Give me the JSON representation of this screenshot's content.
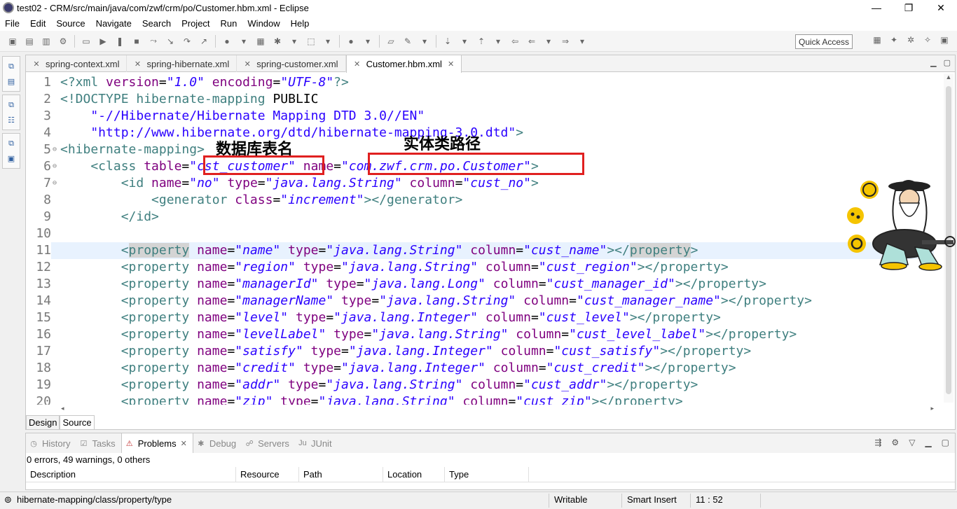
{
  "window": {
    "title": "test02 - CRM/src/main/java/com/zwf/crm/po/Customer.hbm.xml - Eclipse",
    "minimize": "—",
    "restore": "❐",
    "close": "✕"
  },
  "menu": [
    "File",
    "Edit",
    "Source",
    "Navigate",
    "Search",
    "Project",
    "Run",
    "Window",
    "Help"
  ],
  "toolbar": {
    "quick_access": "Quick Access"
  },
  "editor_tabs": [
    {
      "label": "spring-context.xml",
      "active": false
    },
    {
      "label": "spring-hibernate.xml",
      "active": false
    },
    {
      "label": "spring-customer.xml",
      "active": false
    },
    {
      "label": "Customer.hbm.xml",
      "active": true
    }
  ],
  "code_lines": [
    {
      "n": "1",
      "fold": "",
      "segs": [
        [
          "k",
          "<?xml "
        ],
        [
          "a",
          "version"
        ],
        [
          "p",
          "="
        ],
        [
          "v",
          "\"1.0\""
        ],
        [
          "a",
          " encoding"
        ],
        [
          "p",
          "="
        ],
        [
          "v",
          "\"UTF-8\""
        ],
        [
          "k",
          "?>"
        ]
      ]
    },
    {
      "n": "2",
      "fold": "",
      "segs": [
        [
          "k",
          "<!DOCTYPE hibernate-mapping "
        ],
        [
          "p",
          "PUBLIC"
        ]
      ]
    },
    {
      "n": "3",
      "fold": "",
      "segs": [
        [
          "dq",
          "    \"-//Hibernate/Hibernate Mapping DTD 3.0//EN\""
        ]
      ]
    },
    {
      "n": "4",
      "fold": "",
      "segs": [
        [
          "dq",
          "    \"http://www.hibernate.org/dtd/hibernate-mapping-3.0.dtd\""
        ],
        [
          "k",
          ">"
        ]
      ]
    },
    {
      "n": "5",
      "fold": "⊖",
      "segs": [
        [
          "k",
          "<hibernate-mapping>"
        ]
      ]
    },
    {
      "n": "6",
      "fold": "⊖",
      "segs": [
        [
          "k",
          "    <class "
        ],
        [
          "a",
          "table"
        ],
        [
          "p",
          "="
        ],
        [
          "v",
          "\"cst_customer\""
        ],
        [
          "a",
          " name"
        ],
        [
          "p",
          "="
        ],
        [
          "v",
          "\"com.zwf.crm.po.Customer\""
        ],
        [
          "k",
          ">"
        ]
      ]
    },
    {
      "n": "7",
      "fold": "⊖",
      "segs": [
        [
          "k",
          "        <id "
        ],
        [
          "a",
          "name"
        ],
        [
          "p",
          "="
        ],
        [
          "v",
          "\"no\""
        ],
        [
          "a",
          " type"
        ],
        [
          "p",
          "="
        ],
        [
          "v",
          "\"java.lang.String\""
        ],
        [
          "a",
          " column"
        ],
        [
          "p",
          "="
        ],
        [
          "v",
          "\"cust_no\""
        ],
        [
          "k",
          ">"
        ]
      ]
    },
    {
      "n": "8",
      "fold": "",
      "segs": [
        [
          "k",
          "            <generator "
        ],
        [
          "a",
          "class"
        ],
        [
          "p",
          "="
        ],
        [
          "v",
          "\"increment\""
        ],
        [
          "k",
          "></generator>"
        ]
      ]
    },
    {
      "n": "9",
      "fold": "",
      "segs": [
        [
          "k",
          "        </id>"
        ]
      ]
    },
    {
      "n": "10",
      "fold": "",
      "segs": [
        [
          "p",
          ""
        ]
      ]
    },
    {
      "n": "11",
      "fold": "",
      "current": true,
      "segs": [
        [
          "k",
          "        <"
        ],
        [
          "hlk",
          "property"
        ],
        [
          "a",
          " name"
        ],
        [
          "p",
          "="
        ],
        [
          "v",
          "\"name\""
        ],
        [
          "a",
          " type"
        ],
        [
          "p",
          "="
        ],
        [
          "v",
          "\"java.lang.String\""
        ],
        [
          "a",
          " column"
        ],
        [
          "p",
          "="
        ],
        [
          "v",
          "\"cust_name\""
        ],
        [
          "k",
          "></"
        ],
        [
          "hlk",
          "property"
        ],
        [
          "k",
          ">"
        ]
      ]
    },
    {
      "n": "12",
      "fold": "",
      "segs": [
        [
          "k",
          "        <property "
        ],
        [
          "a",
          "name"
        ],
        [
          "p",
          "="
        ],
        [
          "v",
          "\"region\""
        ],
        [
          "a",
          " type"
        ],
        [
          "p",
          "="
        ],
        [
          "v",
          "\"java.lang.String\""
        ],
        [
          "a",
          " column"
        ],
        [
          "p",
          "="
        ],
        [
          "v",
          "\"cust_region\""
        ],
        [
          "k",
          "></property>"
        ]
      ]
    },
    {
      "n": "13",
      "fold": "",
      "segs": [
        [
          "k",
          "        <property "
        ],
        [
          "a",
          "name"
        ],
        [
          "p",
          "="
        ],
        [
          "v",
          "\"managerId\""
        ],
        [
          "a",
          " type"
        ],
        [
          "p",
          "="
        ],
        [
          "v",
          "\"java.lang.Long\""
        ],
        [
          "a",
          " column"
        ],
        [
          "p",
          "="
        ],
        [
          "v",
          "\"cust_manager_id\""
        ],
        [
          "k",
          "></property>"
        ]
      ]
    },
    {
      "n": "14",
      "fold": "",
      "segs": [
        [
          "k",
          "        <property "
        ],
        [
          "a",
          "name"
        ],
        [
          "p",
          "="
        ],
        [
          "v",
          "\"managerName\""
        ],
        [
          "a",
          " type"
        ],
        [
          "p",
          "="
        ],
        [
          "v",
          "\"java.lang.String\""
        ],
        [
          "a",
          " column"
        ],
        [
          "p",
          "="
        ],
        [
          "v",
          "\"cust_manager_name\""
        ],
        [
          "k",
          "></property>"
        ]
      ]
    },
    {
      "n": "15",
      "fold": "",
      "segs": [
        [
          "k",
          "        <property "
        ],
        [
          "a",
          "name"
        ],
        [
          "p",
          "="
        ],
        [
          "v",
          "\"level\""
        ],
        [
          "a",
          " type"
        ],
        [
          "p",
          "="
        ],
        [
          "v",
          "\"java.lang.Integer\""
        ],
        [
          "a",
          " column"
        ],
        [
          "p",
          "="
        ],
        [
          "v",
          "\"cust_level\""
        ],
        [
          "k",
          "></property>"
        ]
      ]
    },
    {
      "n": "16",
      "fold": "",
      "segs": [
        [
          "k",
          "        <property "
        ],
        [
          "a",
          "name"
        ],
        [
          "p",
          "="
        ],
        [
          "v",
          "\"levelLabel\""
        ],
        [
          "a",
          " type"
        ],
        [
          "p",
          "="
        ],
        [
          "v",
          "\"java.lang.String\""
        ],
        [
          "a",
          " column"
        ],
        [
          "p",
          "="
        ],
        [
          "v",
          "\"cust_level_label\""
        ],
        [
          "k",
          "></property>"
        ]
      ]
    },
    {
      "n": "17",
      "fold": "",
      "segs": [
        [
          "k",
          "        <property "
        ],
        [
          "a",
          "name"
        ],
        [
          "p",
          "="
        ],
        [
          "v",
          "\"satisfy\""
        ],
        [
          "a",
          " type"
        ],
        [
          "p",
          "="
        ],
        [
          "v",
          "\"java.lang.Integer\""
        ],
        [
          "a",
          " column"
        ],
        [
          "p",
          "="
        ],
        [
          "v",
          "\"cust_satisfy\""
        ],
        [
          "k",
          "></property>"
        ]
      ]
    },
    {
      "n": "18",
      "fold": "",
      "segs": [
        [
          "k",
          "        <property "
        ],
        [
          "a",
          "name"
        ],
        [
          "p",
          "="
        ],
        [
          "v",
          "\"credit\""
        ],
        [
          "a",
          " type"
        ],
        [
          "p",
          "="
        ],
        [
          "v",
          "\"java.lang.Integer\""
        ],
        [
          "a",
          " column"
        ],
        [
          "p",
          "="
        ],
        [
          "v",
          "\"cust_credit\""
        ],
        [
          "k",
          "></property>"
        ]
      ]
    },
    {
      "n": "19",
      "fold": "",
      "segs": [
        [
          "k",
          "        <property "
        ],
        [
          "a",
          "name"
        ],
        [
          "p",
          "="
        ],
        [
          "v",
          "\"addr\""
        ],
        [
          "a",
          " type"
        ],
        [
          "p",
          "="
        ],
        [
          "v",
          "\"java.lang.String\""
        ],
        [
          "a",
          " column"
        ],
        [
          "p",
          "="
        ],
        [
          "v",
          "\"cust_addr\""
        ],
        [
          "k",
          "></property>"
        ]
      ]
    },
    {
      "n": "20",
      "fold": "",
      "segs": [
        [
          "k",
          "        <property "
        ],
        [
          "a",
          "name"
        ],
        [
          "p",
          "="
        ],
        [
          "v",
          "\"zip\""
        ],
        [
          "a",
          " type"
        ],
        [
          "p",
          "="
        ],
        [
          "v",
          "\"java.lang.String\""
        ],
        [
          "a",
          " column"
        ],
        [
          "p",
          "="
        ],
        [
          "v",
          "\"cust_zip\""
        ],
        [
          "k",
          "></property>"
        ]
      ]
    }
  ],
  "annotations": {
    "table_label": "数据库表名",
    "class_label": "实体类路径"
  },
  "editor_bottom_tabs": [
    "Design",
    "Source"
  ],
  "panel": {
    "tabs": [
      {
        "label": "History",
        "active": false,
        "icon": "history-icon"
      },
      {
        "label": "Tasks",
        "active": false,
        "icon": "tasks-icon"
      },
      {
        "label": "Problems",
        "active": true,
        "icon": "problems-icon"
      },
      {
        "label": "Debug",
        "active": false,
        "icon": "debug-icon"
      },
      {
        "label": "Servers",
        "active": false,
        "icon": "servers-icon"
      },
      {
        "label": "JUnit",
        "active": false,
        "icon": "junit-icon"
      }
    ],
    "summary": "0 errors, 49 warnings, 0 others",
    "columns": [
      "Description",
      "Resource",
      "Path",
      "Location",
      "Type"
    ]
  },
  "statusbar": {
    "path": "hibernate-mapping/class/property/type",
    "writable": "Writable",
    "insert_mode": "Smart Insert",
    "position": "11 : 52"
  }
}
